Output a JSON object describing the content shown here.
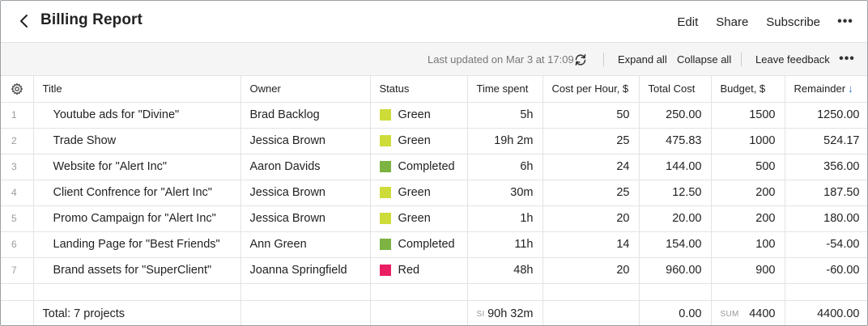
{
  "header": {
    "title": "Billing Report",
    "actions": {
      "edit": "Edit",
      "share": "Share",
      "subscribe": "Subscribe"
    }
  },
  "toolbar": {
    "last_updated": "Last updated on Mar 3 at 17:09",
    "expand_all": "Expand all",
    "collapse_all": "Collapse all",
    "leave_feedback": "Leave feedback"
  },
  "columns": {
    "title": "Title",
    "owner": "Owner",
    "status": "Status",
    "time_spent": "Time spent",
    "cost_per_hour": "Cost per Hour, $",
    "total_cost": "Total Cost",
    "budget": "Budget, $",
    "remainder": "Remainder",
    "remainder_sort": "↓"
  },
  "status_colors": {
    "Green": "#cddc39",
    "Completed": "#7cb342",
    "Red": "#e91e63"
  },
  "rows": [
    {
      "idx": "1",
      "title": "Youtube ads for \"Divine\"",
      "owner": "Brad Backlog",
      "status": "Green",
      "time": "5h",
      "cph": "50",
      "total": "250.00",
      "budget": "1500",
      "remainder": "1250.00"
    },
    {
      "idx": "2",
      "title": "Trade Show",
      "owner": "Jessica Brown",
      "status": "Green",
      "time": "19h 2m",
      "cph": "25",
      "total": "475.83",
      "budget": "1000",
      "remainder": "524.17"
    },
    {
      "idx": "3",
      "title": "Website for \"Alert Inc\"",
      "owner": "Aaron Davids",
      "status": "Completed",
      "time": "6h",
      "cph": "24",
      "total": "144.00",
      "budget": "500",
      "remainder": "356.00"
    },
    {
      "idx": "4",
      "title": "Client Confrence for  \"Alert Inc\"",
      "owner": "Jessica Brown",
      "status": "Green",
      "time": "30m",
      "cph": "25",
      "total": "12.50",
      "budget": "200",
      "remainder": "187.50"
    },
    {
      "idx": "5",
      "title": "Promo Campaign for \"Alert Inc\"",
      "owner": "Jessica Brown",
      "status": "Green",
      "time": "1h",
      "cph": "20",
      "total": "20.00",
      "budget": "200",
      "remainder": "180.00"
    },
    {
      "idx": "6",
      "title": "Landing Page for \"Best Friends\"",
      "owner": "Ann Green",
      "status": "Completed",
      "time": "11h",
      "cph": "14",
      "total": "154.00",
      "budget": "100",
      "remainder": "-54.00"
    },
    {
      "idx": "7",
      "title": "Brand assets for \"SuperClient\"",
      "owner": "Joanna Springfield",
      "status": "Red",
      "time": "48h",
      "cph": "20",
      "total": "960.00",
      "budget": "900",
      "remainder": "-60.00"
    }
  ],
  "totals": {
    "label": "Total: 7 projects",
    "time_prefix": "SI",
    "time": "90h 32m",
    "total_cost": "0.00",
    "budget_prefix": "SUM",
    "budget": "4400",
    "remainder": "4400.00"
  }
}
